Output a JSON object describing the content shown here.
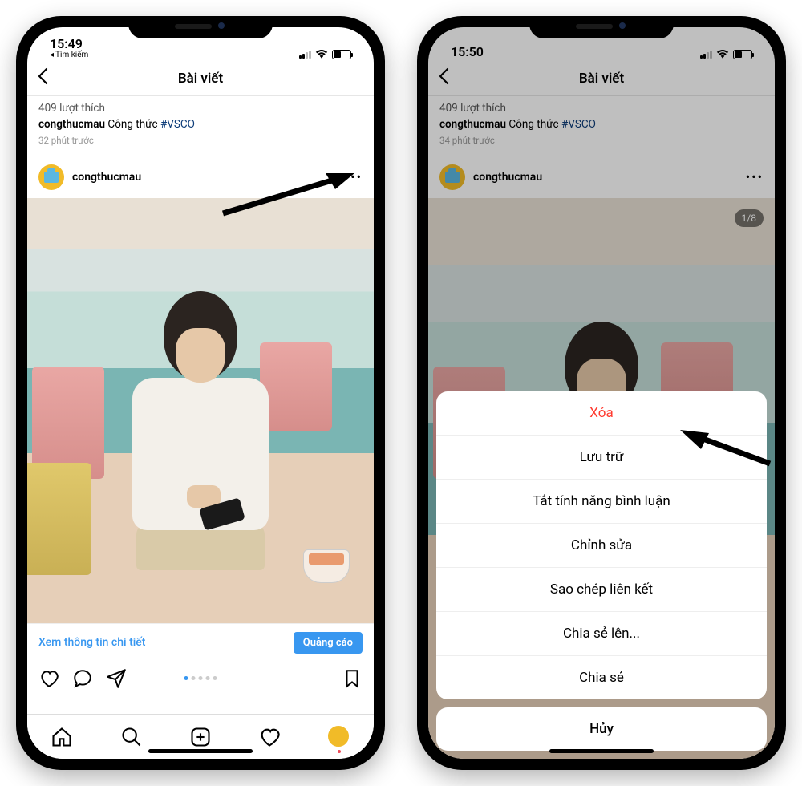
{
  "leftPhone": {
    "status": {
      "time": "15:49",
      "backSearch": "Tìm kiếm"
    },
    "nav": {
      "title": "Bài viết"
    },
    "prevPost": {
      "likes": "409 lượt thích",
      "username": "congthucmau",
      "caption": "Công thức",
      "hashtag": "#VSCO",
      "time": "32 phút trước"
    },
    "postHeader": {
      "username": "congthucmau"
    },
    "adRow": {
      "detail": "Xem thông tin chi tiết",
      "cta": "Quảng cáo"
    }
  },
  "rightPhone": {
    "status": {
      "time": "15:50"
    },
    "nav": {
      "title": "Bài viết"
    },
    "prevPost": {
      "likes": "409 lượt thích",
      "username": "congthucmau",
      "caption": "Công thức",
      "hashtag": "#VSCO",
      "time": "34 phút trước"
    },
    "postHeader": {
      "username": "congthucmau"
    },
    "carouselBadge": "1/8",
    "sheet": {
      "delete": "Xóa",
      "items": [
        "Lưu trữ",
        "Tắt tính năng bình luận",
        "Chỉnh sửa",
        "Sao chép liên kết",
        "Chia sẻ lên...",
        "Chia sẻ"
      ],
      "cancel": "Hủy"
    }
  }
}
